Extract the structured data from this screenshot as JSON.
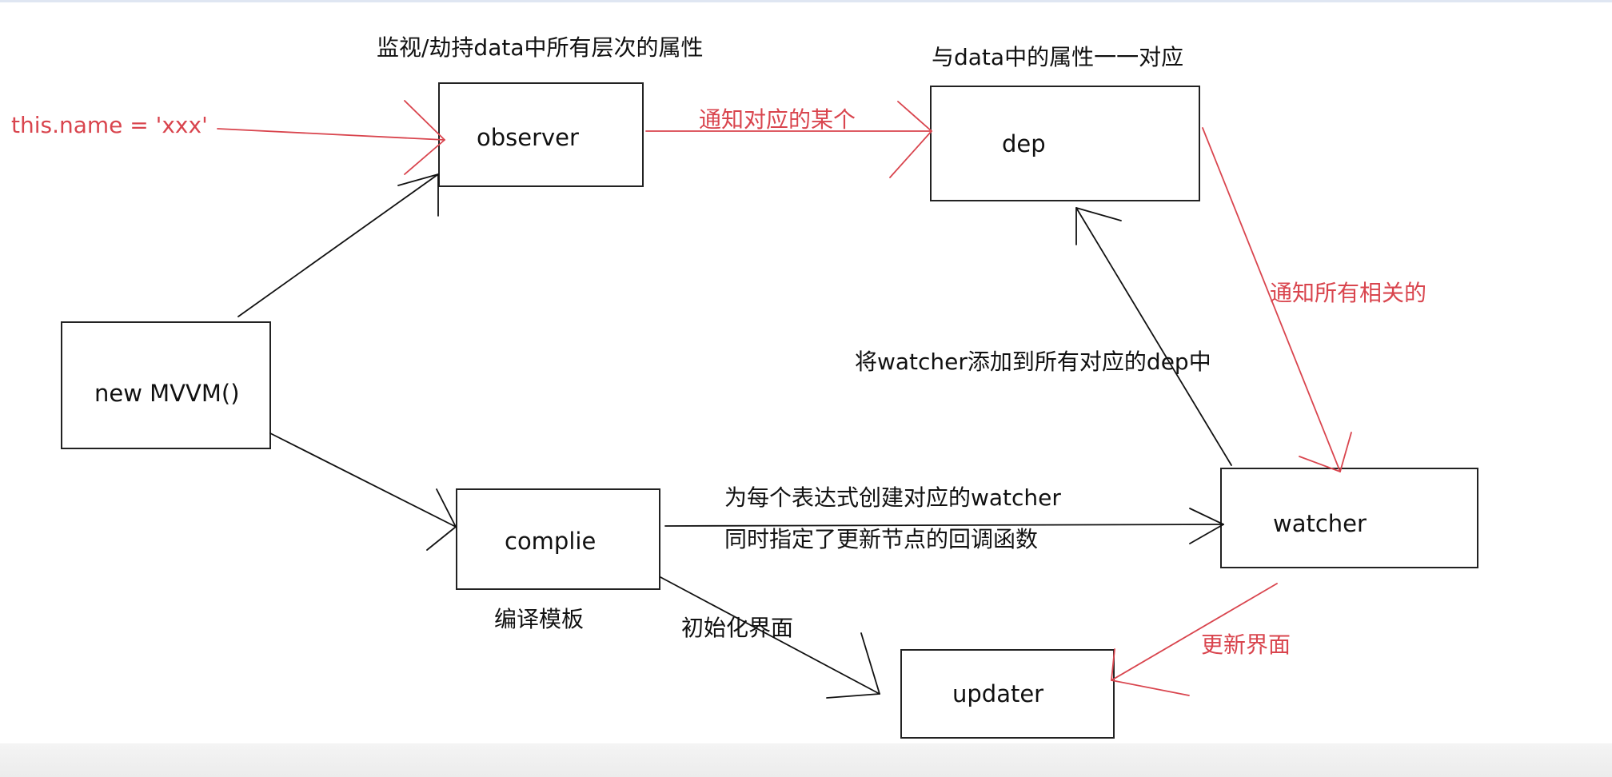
{
  "nodes": {
    "observer": "observer",
    "dep": "dep",
    "mvvm": "new MVVM()",
    "compile": "complie",
    "watcher": "watcher",
    "updater": "updater"
  },
  "labels": {
    "observer_note": "监视/劫持data中所有层次的属性",
    "dep_note": "与data中的属性一一对应",
    "assignment": "this.name = 'xxx'",
    "notify_one": "通知对应的某个",
    "notify_all": "通知所有相关的",
    "add_watcher": "将watcher添加到所有对应的dep中",
    "create_watcher_line1": "为每个表达式创建对应的watcher",
    "create_watcher_line2": "同时指定了更新节点的回调函数",
    "compile_note": "编译模板",
    "init_view": "初始化界面",
    "update_view": "更新界面"
  },
  "colors": {
    "black": "#111111",
    "red": "#d9454e"
  }
}
